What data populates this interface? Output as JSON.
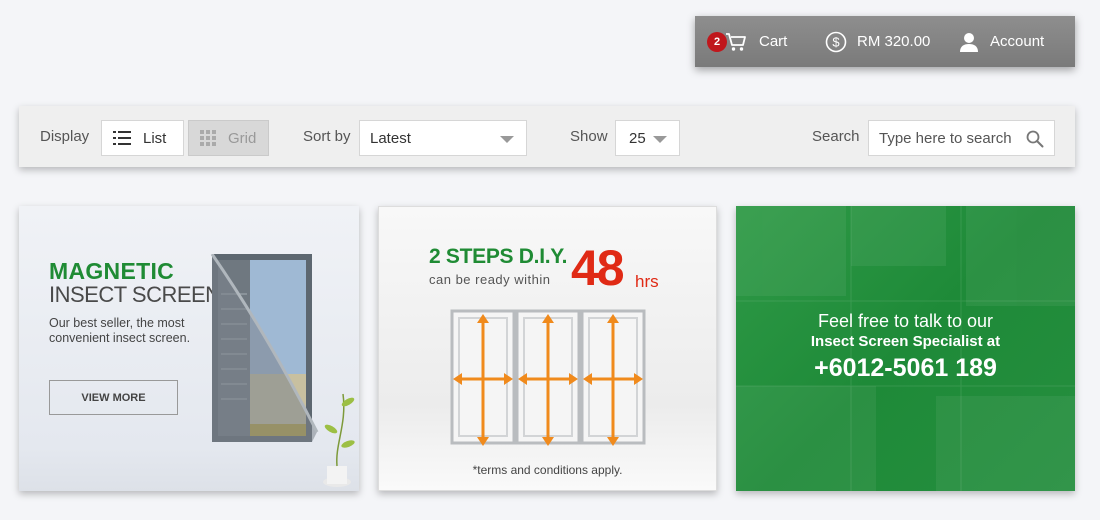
{
  "topbar": {
    "cart_count": "2",
    "cart_label": "Cart",
    "amount": "RM 320.00",
    "account_label": "Account"
  },
  "toolbar": {
    "display_label": "Display",
    "list_label": "List",
    "grid_label": "Grid",
    "sort_label": "Sort by",
    "sort_value": "Latest",
    "show_label": "Show",
    "show_value": "25",
    "search_label": "Search",
    "search_placeholder": "Type here to search"
  },
  "banners": [
    {
      "title_line1": "MAGNETIC",
      "title_line2": "INSECT SCREEN",
      "description": "Our best seller, the most convenient insect screen.",
      "button_label": "VIEW MORE"
    },
    {
      "title": "2 STEPS D.I.Y.",
      "subtitle": "can be ready within",
      "number": "48",
      "unit": "hrs",
      "note": "*terms and conditions apply."
    },
    {
      "line1": "Feel free to talk to our",
      "line2": "Insect Screen Specialist at",
      "phone": "+6012-5061 189"
    }
  ],
  "colors": {
    "brand_green": "#1f8b34",
    "accent_red": "#e02a15",
    "badge_red": "#c0171c",
    "topbar_gray": "#808080"
  }
}
